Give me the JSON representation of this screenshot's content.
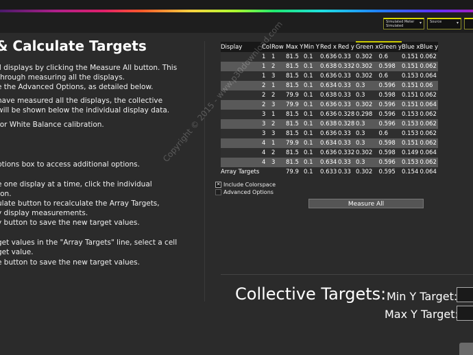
{
  "toolbar": {
    "dropdowns": [
      {
        "label": "Simulated Meter\nSimulated"
      },
      {
        "label": "Source"
      },
      {
        "label": ""
      }
    ]
  },
  "page": {
    "title": "& Calculate Targets",
    "instructions": [
      "ll displays by clicking the Measure All button. This",
      "through measuring all the displays.",
      "e the Advanced Options, as detailed below.",
      "have measured all the displays, the collective",
      "will be shown below the individual display data.",
      "for White Balance calibration.",
      "ptions box to access additional options.",
      "e one display at a time, click the individual",
      "ton.",
      "ulate button to recalculate the Array Targets,",
      "y display measurements.",
      "y button to save the new target values.",
      "get values in the \"Array Targets\" line, select a cell",
      "get value.",
      "e button to save the new target values."
    ]
  },
  "grid": {
    "columns": [
      "Display",
      "Col",
      "Row",
      "Max Y",
      "Min Y",
      "Red x",
      "Red y",
      "Green x",
      "Green y",
      "Blue x",
      "Blue y"
    ],
    "rows": [
      [
        "",
        "1",
        "1",
        "81.5",
        "0.1",
        "0.636",
        "0.33",
        "0.302",
        "0.6",
        "0.151",
        "0.062"
      ],
      [
        "",
        "1",
        "2",
        "81.5",
        "0.1",
        "0.638",
        "0.332",
        "0.302",
        "0.598",
        "0.151",
        "0.062"
      ],
      [
        "",
        "1",
        "3",
        "81.5",
        "0.1",
        "0.636",
        "0.33",
        "0.302",
        "0.6",
        "0.153",
        "0.064"
      ],
      [
        "",
        "2",
        "1",
        "81.5",
        "0.1",
        "0.634",
        "0.33",
        "0.3",
        "0.596",
        "0.151",
        "0.06"
      ],
      [
        "",
        "2",
        "2",
        "79.9",
        "0.1",
        "0.638",
        "0.33",
        "0.3",
        "0.598",
        "0.151",
        "0.062"
      ],
      [
        "",
        "2",
        "3",
        "79.9",
        "0.1",
        "0.636",
        "0.33",
        "0.302",
        "0.596",
        "0.151",
        "0.064"
      ],
      [
        "",
        "3",
        "1",
        "81.5",
        "0.1",
        "0.636",
        "0.328",
        "0.298",
        "0.596",
        "0.153",
        "0.062"
      ],
      [
        "",
        "3",
        "2",
        "81.5",
        "0.1",
        "0.638",
        "0.328",
        "0.3",
        "0.596",
        "0.153",
        "0.062"
      ],
      [
        "",
        "3",
        "3",
        "81.5",
        "0.1",
        "0.636",
        "0.33",
        "0.3",
        "0.6",
        "0.153",
        "0.062"
      ],
      [
        "",
        "4",
        "1",
        "79.9",
        "0.1",
        "0.634",
        "0.33",
        "0.3",
        "0.598",
        "0.151",
        "0.062"
      ],
      [
        "",
        "4",
        "2",
        "81.5",
        "0.1",
        "0.636",
        "0.332",
        "0.302",
        "0.598",
        "0.149",
        "0.064"
      ],
      [
        "",
        "4",
        "3",
        "81.5",
        "0.1",
        "0.634",
        "0.33",
        "0.3",
        "0.596",
        "0.153",
        "0.062"
      ]
    ],
    "array_targets": [
      "Array Targets",
      "",
      "",
      "79.9",
      "0.1",
      "0.633",
      "0.33",
      "0.302",
      "0.595",
      "0.154",
      "0.064"
    ]
  },
  "options": {
    "include_colorspace": "Include Colorspace",
    "include_colorspace_checked": true,
    "advanced_options": "Advanced Options",
    "advanced_options_checked": false
  },
  "buttons": {
    "measure_all": "Measure All"
  },
  "targets": {
    "collective_label": "Collective Targets:",
    "min_y_label": "Min Y Target:",
    "max_y_label": "Max Y Target:",
    "min_y_value": "",
    "max_y_value": ""
  },
  "watermark": "Copyright © 2015 - www.p30download.com"
}
